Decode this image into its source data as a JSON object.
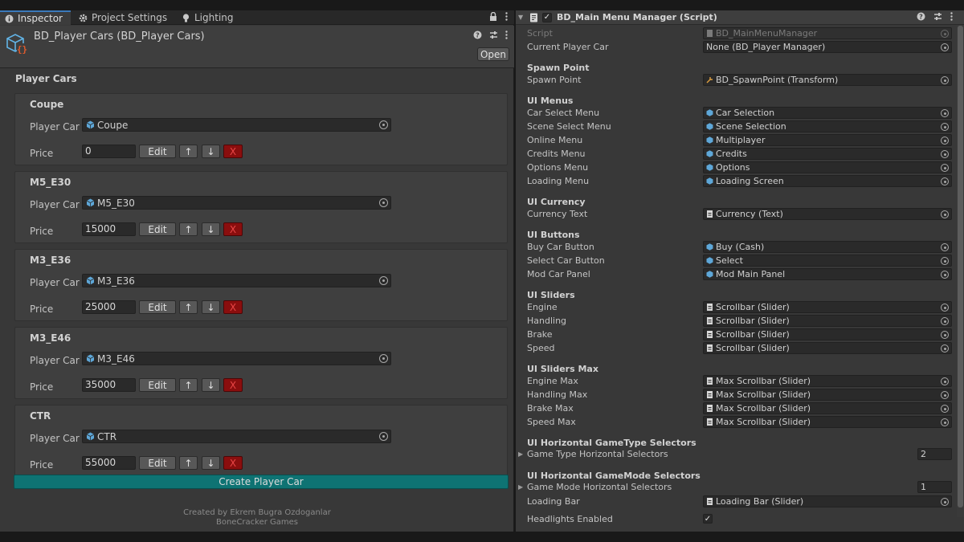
{
  "tabs": [
    {
      "label": "Inspector",
      "icon": "info-icon"
    },
    {
      "label": "Project Settings",
      "icon": "gear-icon"
    },
    {
      "label": "Lighting",
      "icon": "lightbulb-icon"
    }
  ],
  "asset": {
    "title": "BD_Player Cars (BD_Player Cars)",
    "open_label": "Open"
  },
  "section_title": "Player Cars",
  "player_car_label": "Player Car I",
  "price_label": "Price",
  "edit_label": "Edit",
  "up_label": "↑",
  "down_label": "↓",
  "remove_label": "X",
  "cars": [
    {
      "name": "Coupe",
      "car": "Coupe",
      "price": "0"
    },
    {
      "name": "M5_E30",
      "car": "M5_E30",
      "price": "15000"
    },
    {
      "name": "M3_E36",
      "car": "M3_E36",
      "price": "25000"
    },
    {
      "name": "M3_E46",
      "car": "M3_E46",
      "price": "35000"
    },
    {
      "name": "CTR",
      "car": "CTR",
      "price": "55000"
    }
  ],
  "create_button": "Create Player Car",
  "credits": [
    "Created by Ekrem Bugra Ozdoganlar",
    "BoneCracker Games"
  ],
  "component": {
    "title": "BD_Main Menu Manager (Script)",
    "enabled": true
  },
  "props": {
    "script": {
      "label": "Script",
      "value": "BD_MainMenuManager"
    },
    "current_player_car": {
      "label": "Current Player Car",
      "value": "None (BD_Player Manager)"
    },
    "spawn_header": "Spawn Point",
    "spawn_point": {
      "label": "Spawn Point",
      "value": "BD_SpawnPoint (Transform)"
    },
    "menus_header": "UI Menus",
    "menus": [
      {
        "label": "Car Select Menu",
        "value": "Car Selection"
      },
      {
        "label": "Scene Select Menu",
        "value": "Scene Selection"
      },
      {
        "label": "Online Menu",
        "value": "Multiplayer"
      },
      {
        "label": "Credits Menu",
        "value": "Credits"
      },
      {
        "label": "Options Menu",
        "value": "Options"
      },
      {
        "label": "Loading Menu",
        "value": "Loading Screen"
      }
    ],
    "currency_header": "UI Currency",
    "currency_text": {
      "label": "Currency Text",
      "value": "Currency (Text)"
    },
    "buttons_header": "UI Buttons",
    "buttons": [
      {
        "label": "Buy Car Button",
        "value": "Buy (Cash)"
      },
      {
        "label": "Select Car Button",
        "value": "Select"
      },
      {
        "label": "Mod Car Panel",
        "value": "Mod Main Panel"
      }
    ],
    "sliders_header": "UI Sliders",
    "sliders": [
      {
        "label": "Engine",
        "value": "Scrollbar (Slider)"
      },
      {
        "label": "Handling",
        "value": "Scrollbar (Slider)"
      },
      {
        "label": "Brake",
        "value": "Scrollbar (Slider)"
      },
      {
        "label": "Speed",
        "value": "Scrollbar (Slider)"
      }
    ],
    "sliders_max_header": "UI Sliders Max",
    "sliders_max": [
      {
        "label": "Engine Max",
        "value": "Max Scrollbar (Slider)"
      },
      {
        "label": "Handling Max",
        "value": "Max Scrollbar (Slider)"
      },
      {
        "label": "Brake Max",
        "value": "Max Scrollbar (Slider)"
      },
      {
        "label": "Speed Max",
        "value": "Max Scrollbar (Slider)"
      }
    ],
    "gametype_header": "UI Horizontal GameType Selectors",
    "gametype": {
      "label": "Game Type Horizontal Selectors",
      "count": "2"
    },
    "gamemode_header": "UI Horizontal GameMode Selectors",
    "gamemode": {
      "label": "Game Mode Horizontal Selectors",
      "count": "1"
    },
    "loading_bar": {
      "label": "Loading Bar",
      "value": "Loading Bar (Slider)"
    },
    "headlights": {
      "label": "Headlights Enabled",
      "checked": true
    }
  },
  "colors": {
    "accent": "#3a79bb",
    "create_button": "#0e7373",
    "remove_button": "#8a0e0e"
  }
}
